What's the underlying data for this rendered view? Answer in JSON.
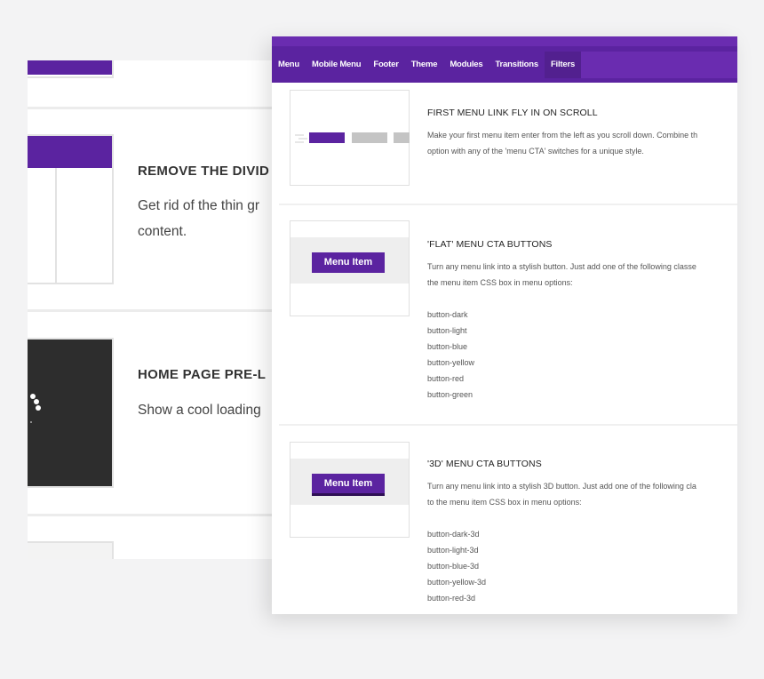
{
  "back_panel": {
    "features": [
      {
        "title": "REMOVE THE DIVID",
        "desc_lines": [
          "Get rid of the thin gr",
          "content."
        ]
      },
      {
        "title": "HOME PAGE PRE-L",
        "desc_lines": [
          "Show a cool loading"
        ]
      }
    ]
  },
  "front_panel": {
    "tabs": [
      "Menu",
      "Mobile Menu",
      "Footer",
      "Theme",
      "Modules",
      "Transitions",
      "Filters"
    ],
    "features": [
      {
        "title": "FIRST MENU LINK FLY IN ON SCROLL",
        "desc_lines": [
          "Make your first menu item enter from the left as you scroll down. Combine th",
          "option with any of the 'menu CTA' switches for a unique style."
        ]
      },
      {
        "title": "'FLAT' MENU CTA BUTTONS",
        "button_label": "Menu Item",
        "desc_lines": [
          "Turn any menu link into a stylish button. Just add one of the following classe",
          "the menu item CSS box in menu options:"
        ],
        "classes": [
          "button-dark",
          "button-light",
          "button-blue",
          "button-yellow",
          "button-red",
          "button-green"
        ]
      },
      {
        "title": "'3D' MENU CTA BUTTONS",
        "button_label": "Menu Item",
        "desc_lines": [
          "Turn any menu link into a stylish 3D button. Just add one of the following cla",
          "to the menu item CSS box in menu options:"
        ],
        "classes": [
          "button-dark-3d",
          "button-light-3d",
          "button-blue-3d",
          "button-yellow-3d",
          "button-red-3d"
        ]
      }
    ]
  },
  "colors": {
    "accent": "#5b23a0",
    "page_bg": "#f3f3f4",
    "loader_bg": "#2d2d2d"
  }
}
